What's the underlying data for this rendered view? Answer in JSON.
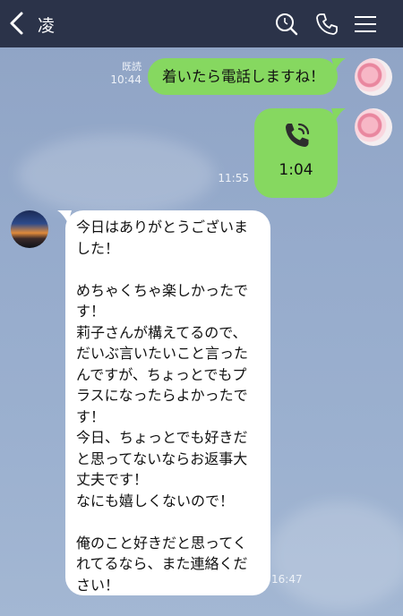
{
  "header": {
    "title": "凌",
    "back_icon": "chevron-left-icon",
    "search_icon": "search-icon",
    "call_icon": "phone-icon",
    "menu_icon": "menu-icon"
  },
  "messages": [
    {
      "type": "sent",
      "text": "着いたら電話しますね！",
      "read": "既読",
      "time": "10:44"
    },
    {
      "type": "call",
      "duration": "1:04",
      "time": "11:55",
      "icon": "phone-call-icon"
    },
    {
      "type": "received",
      "text": "今日はありがとうございました！\n\nめちゃくちゃ楽しかったです！\n莉子さんが構えてるので、だいぶ言いたいこと言ったんですが、ちょっとでもプラスになったらよかったです！\n今日、ちょっとでも好きだと思ってないならお返事大丈夫です！\nなにも嬉しくないので！\n\n俺のこと好きだと思ってくれてるなら、また連絡ください！",
      "time": "16:47"
    }
  ],
  "colors": {
    "header_bg": "#2b3349",
    "sent_bubble": "#86d860",
    "received_bubble": "#ffffff"
  }
}
